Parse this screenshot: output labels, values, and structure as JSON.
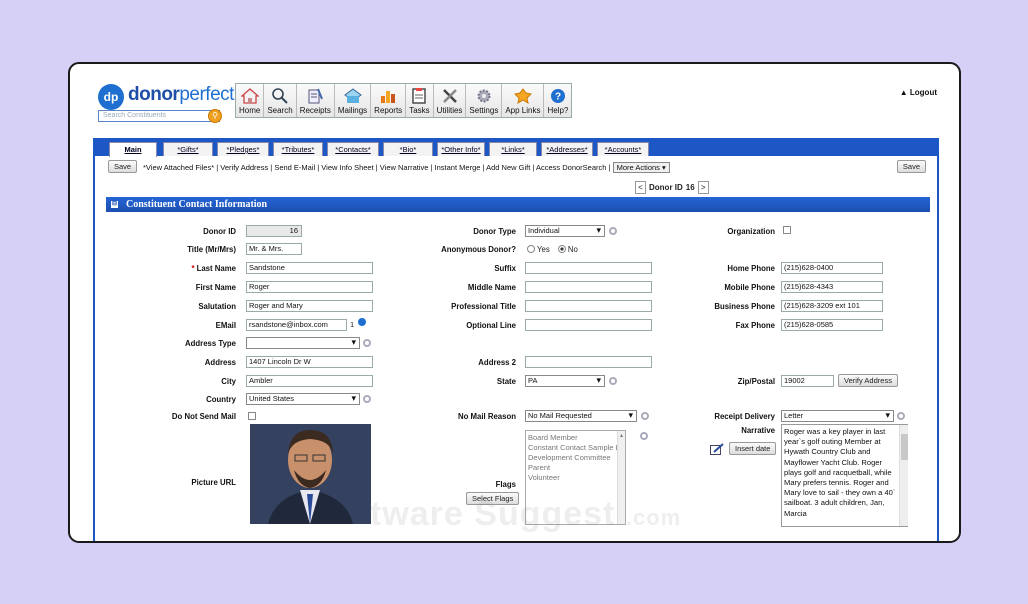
{
  "logo": {
    "mark": "dp",
    "donor": "donor",
    "perfect": "perfect"
  },
  "search": {
    "placeholder": "Search Constituents"
  },
  "toolbar": [
    {
      "label": "Home",
      "icon": "home-icon"
    },
    {
      "label": "Search",
      "icon": "magnifier-icon"
    },
    {
      "label": "Receipts",
      "icon": "receipt-icon"
    },
    {
      "label": "Mailings",
      "icon": "mailings-icon"
    },
    {
      "label": "Reports",
      "icon": "bar-chart-icon"
    },
    {
      "label": "Tasks",
      "icon": "tasks-icon"
    },
    {
      "label": "Utilities",
      "icon": "tools-icon"
    },
    {
      "label": "Settings",
      "icon": "gear-icon"
    },
    {
      "label": "App Links",
      "icon": "puzzle-icon"
    },
    {
      "label": "Help?",
      "icon": "help-icon"
    }
  ],
  "logout": "Logout",
  "tabs": [
    "Main",
    "*Gifts*",
    "*Pledges*",
    "*Tributes*",
    "*Contacts*",
    "*Bio*",
    "*Other Info*",
    "*Links*",
    "*Addresses*",
    "*Accounts*"
  ],
  "actions": {
    "save_left": "Save",
    "save_right": "Save",
    "links": "*View Attached Files* | Verify Address | Send E-Mail | View Info Sheet | View Narrative | Instant Merge | Add New Gift | Access DonorSearch |",
    "more": "More Actions ▾"
  },
  "nav": {
    "prev": "<",
    "label": "Donor ID",
    "value": "16",
    "next": ">"
  },
  "section": {
    "title": "Constituent Contact Information",
    "toggle": "⊟"
  },
  "fields": {
    "donor_id": {
      "label": "Donor ID",
      "value": "16"
    },
    "title": {
      "label": "Title (Mr/Mrs)",
      "value": "Mr. & Mrs."
    },
    "last_name": {
      "label": "Last Name",
      "required": "*",
      "value": "Sandstone"
    },
    "first_name": {
      "label": "First Name",
      "value": "Roger"
    },
    "salutation": {
      "label": "Salutation",
      "value": "Roger and Mary"
    },
    "email": {
      "label": "EMail",
      "value": "rsandstone@inbox.com",
      "count": "1"
    },
    "address_type": {
      "label": "Address Type",
      "value": ""
    },
    "address": {
      "label": "Address",
      "value": "1407 Lincoln Dr W"
    },
    "city": {
      "label": "City",
      "value": "Ambler"
    },
    "country": {
      "label": "Country",
      "value": "United States"
    },
    "do_not_send": {
      "label": "Do Not Send Mail"
    },
    "picture": {
      "label": "Picture URL"
    },
    "donor_type": {
      "label": "Donor Type",
      "value": "Individual"
    },
    "anonymous": {
      "label": "Anonymous Donor?",
      "yes": "Yes",
      "no": "No",
      "selected": "No"
    },
    "suffix": {
      "label": "Suffix",
      "value": ""
    },
    "middle_name": {
      "label": "Middle Name",
      "value": ""
    },
    "professional_title": {
      "label": "Professional Title",
      "value": ""
    },
    "optional_line": {
      "label": "Optional Line",
      "value": ""
    },
    "address2": {
      "label": "Address 2",
      "value": ""
    },
    "state": {
      "label": "State",
      "value": "PA"
    },
    "no_mail_reason": {
      "label": "No Mail Reason",
      "value": "No Mail Requested"
    },
    "flags": {
      "label": "Flags",
      "button": "Select Flags",
      "options": [
        "Board Member",
        "Constant Contact Sample L",
        "Development Committee",
        "Parent",
        "Volunteer"
      ]
    },
    "organization": {
      "label": "Organization"
    },
    "home_phone": {
      "label": "Home Phone",
      "value": "(215)628-0400"
    },
    "mobile_phone": {
      "label": "Mobile Phone",
      "value": "(215)628-4343"
    },
    "business_phone": {
      "label": "Business Phone",
      "value": "(215)628-3209 ext 101"
    },
    "fax_phone": {
      "label": "Fax Phone",
      "value": "(215)628-0585"
    },
    "zip": {
      "label": "Zip/Postal",
      "value": "19002",
      "button": "Verify Address"
    },
    "receipt_delivery": {
      "label": "Receipt Delivery",
      "value": "Letter"
    },
    "narrative": {
      "label": "Narrative",
      "button": "Insert date",
      "value": "Roger was a key player in last year`s golf outing Member at Hywath Country Club and Mayflower Yacht Club.  Roger plays golf and racquetball, while Mary prefers tennis.  Roger and Mary love to sail - they own a 40` sailboat.   3 adult children, Jan, Marcia"
    }
  },
  "watermark": {
    "main": "tware Suggest",
    "suffix": ".com"
  }
}
